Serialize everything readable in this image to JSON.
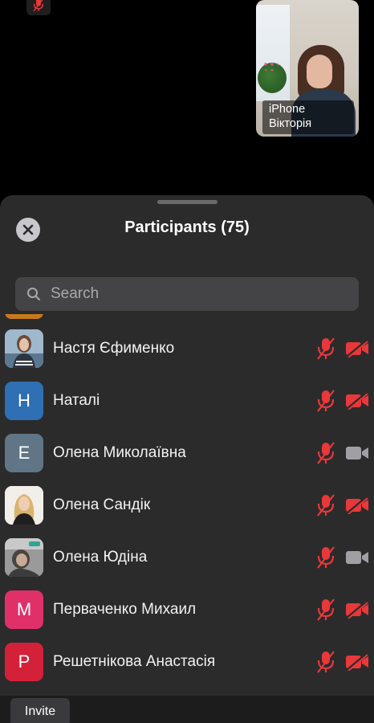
{
  "video": {
    "device_label": "iPhone",
    "name": "Вікторія"
  },
  "panel": {
    "title": "Participants (75)"
  },
  "search": {
    "placeholder": "Search"
  },
  "participants": [
    {
      "name": "Настя Єфименко",
      "avatar_type": "photo",
      "mic": "muted",
      "camera": "off"
    },
    {
      "name": "Наталі",
      "initial": "Н",
      "avatar_color": "#2f6fb3",
      "mic": "muted",
      "camera": "off"
    },
    {
      "name": "Олена Миколаївна",
      "initial": "Е",
      "avatar_color": "#607585",
      "mic": "muted",
      "camera": "on"
    },
    {
      "name": "Олена Сандік",
      "avatar_type": "photo",
      "mic": "muted",
      "camera": "off"
    },
    {
      "name": "Олена Юдіна",
      "avatar_type": "photo",
      "mic": "muted",
      "camera": "on"
    },
    {
      "name": "Перваченко Михаил",
      "initial": "М",
      "avatar_color": "#e0306a",
      "mic": "muted",
      "camera": "off"
    },
    {
      "name": "Решетнікова Анастасія",
      "initial": "Р",
      "avatar_color": "#d4213a",
      "mic": "muted",
      "camera": "off"
    }
  ],
  "footer": {
    "invite_label": "Invite"
  },
  "colors": {
    "muted_red": "#e8383a",
    "camera_on_gray": "#a0a0a4",
    "panel_bg": "#2b2b2c"
  },
  "icons": {
    "mic_muted": "mic-muted-icon",
    "camera_off": "camera-off-icon",
    "camera_on": "camera-icon",
    "search": "search-icon",
    "close": "close-icon"
  }
}
